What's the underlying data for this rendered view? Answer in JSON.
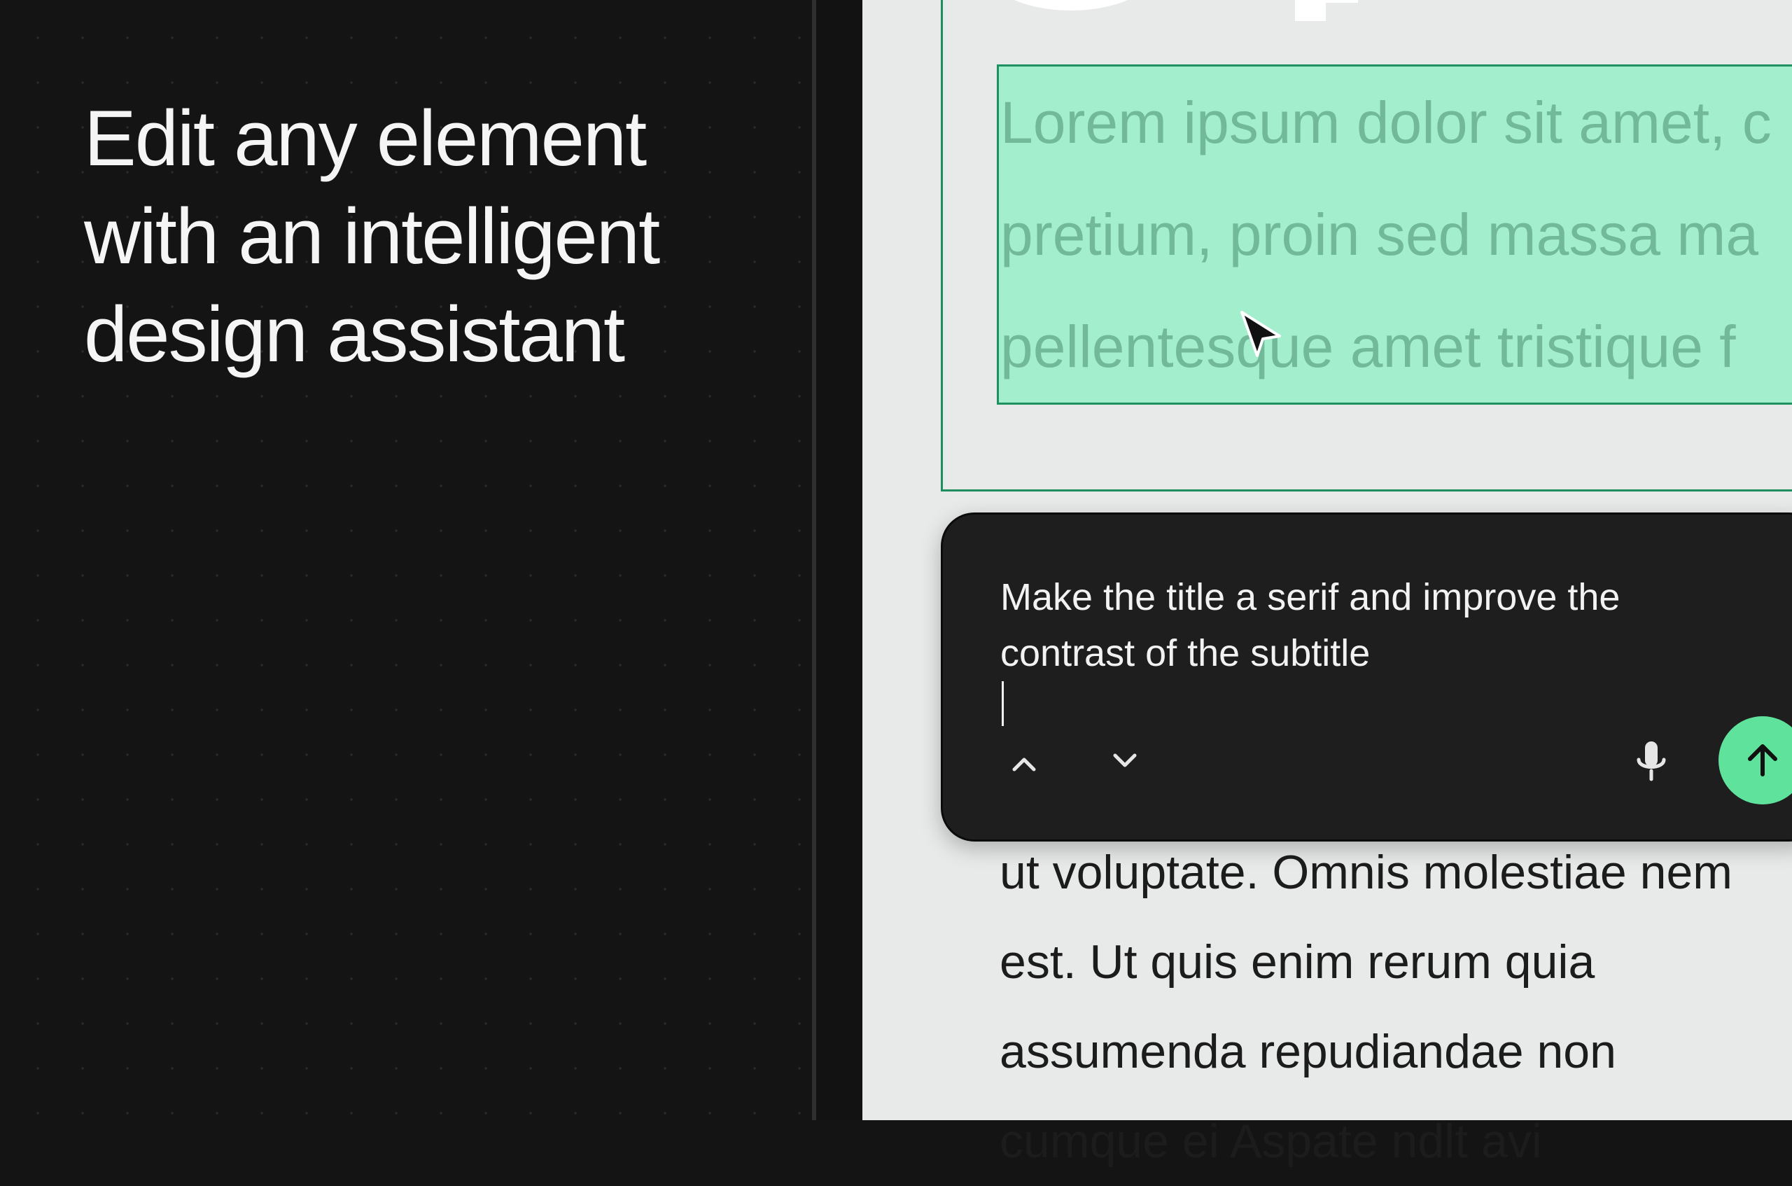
{
  "hero": {
    "headline_lines": [
      "Edit any element",
      "with an intelligent",
      "design assistant"
    ]
  },
  "canvas": {
    "highlighted_paragraph_lines": [
      "Lorem ipsum dolor sit amet, c",
      "pretium, proin sed massa ma",
      "pellentesque amet tristique f"
    ],
    "body_paragraph_lines": [
      "ut voluptate. Omnis molestiae nem",
      "est. Ut quis enim rerum quia",
      "assumenda repudiandae non",
      "cumque ei Aspate ndlt avi"
    ]
  },
  "prompt_panel": {
    "input_lines": [
      "Make the title a serif and improve the",
      "contrast of the subtitle"
    ],
    "icons": {
      "previous": "chevron-up-icon",
      "next": "chevron-down-icon",
      "voice": "microphone-icon",
      "send": "arrow-up-icon"
    }
  },
  "colors": {
    "panel_background": "#141414",
    "canvas_background": "#e8eae9",
    "selection_green": "#a3eecc",
    "selection_border": "#1f9160",
    "send_button": "#5fe39c",
    "prompt_background": "#1e1e1e"
  }
}
